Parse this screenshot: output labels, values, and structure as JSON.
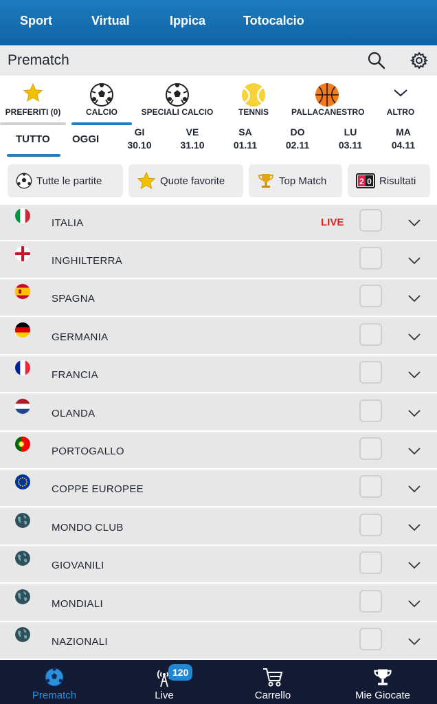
{
  "topnav": {
    "items": [
      {
        "label": "Sport"
      },
      {
        "label": "Virtual"
      },
      {
        "label": "Ippica"
      },
      {
        "label": "Totocalcio"
      }
    ]
  },
  "header": {
    "title": "Prematch",
    "search_icon": "search-icon",
    "settings_icon": "gear-icon"
  },
  "sports": [
    {
      "label": "PREFERITI (0)",
      "icon": "star-icon"
    },
    {
      "label": "CALCIO",
      "icon": "soccer-ball-icon",
      "active": true
    },
    {
      "label": "SPECIALI CALCIO",
      "icon": "soccer-ball-icon"
    },
    {
      "label": "TENNIS",
      "icon": "tennis-ball-icon"
    },
    {
      "label": "PALLACANESTRO",
      "icon": "basketball-icon"
    },
    {
      "label": "ALTRO",
      "icon": "chevron-down-icon"
    }
  ],
  "dates": {
    "all": "TUTTO",
    "today": "OGGI",
    "days": [
      {
        "day": "GI",
        "date": "30.10"
      },
      {
        "day": "VE",
        "date": "31.10"
      },
      {
        "day": "SA",
        "date": "01.11"
      },
      {
        "day": "DO",
        "date": "02.11"
      },
      {
        "day": "LU",
        "date": "03.11"
      },
      {
        "day": "MA",
        "date": "04.11"
      }
    ]
  },
  "filters": [
    {
      "label": "Tutte le partite",
      "icon": "soccer-ball-icon"
    },
    {
      "label": "Quote favorite",
      "icon": "star-icon"
    },
    {
      "label": "Top Match",
      "icon": "trophy-icon"
    },
    {
      "label": "Risultati",
      "icon": "scoreboard-icon",
      "score": "2:0"
    }
  ],
  "countries": [
    {
      "name": "ITALIA",
      "flag": "italy-flag-icon",
      "live": "LIVE"
    },
    {
      "name": "INGHILTERRA",
      "flag": "england-flag-icon"
    },
    {
      "name": "SPAGNA",
      "flag": "spain-flag-icon"
    },
    {
      "name": "GERMANIA",
      "flag": "germany-flag-icon"
    },
    {
      "name": "FRANCIA",
      "flag": "france-flag-icon"
    },
    {
      "name": "OLANDA",
      "flag": "netherlands-flag-icon"
    },
    {
      "name": "PORTOGALLO",
      "flag": "portugal-flag-icon"
    },
    {
      "name": "COPPE EUROPEE",
      "flag": "eu-flag-icon"
    },
    {
      "name": "MONDO CLUB",
      "flag": "globe-icon"
    },
    {
      "name": "GIOVANILI",
      "flag": "globe-icon"
    },
    {
      "name": "MONDIALI",
      "flag": "globe-icon"
    },
    {
      "name": "NAZIONALI",
      "flag": "globe-icon"
    }
  ],
  "bottomnav": {
    "items": [
      {
        "label": "Prematch",
        "icon": "soccer-ball-icon",
        "active": true
      },
      {
        "label": "Live",
        "icon": "antenna-icon",
        "badge": "120"
      },
      {
        "label": "Carrello",
        "icon": "cart-icon"
      },
      {
        "label": "Mie Giocate",
        "icon": "trophy-icon"
      }
    ]
  },
  "colors": {
    "brand": "#1677b8",
    "live": "#e21b1b",
    "bottom_bar": "#131a33",
    "accent": "#2b8fdc"
  }
}
